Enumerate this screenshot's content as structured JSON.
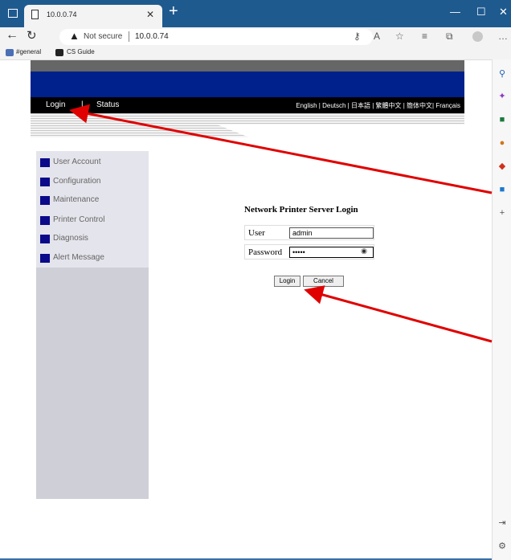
{
  "browser": {
    "tab_title": "10.0.0.74",
    "not_secure": "Not secure",
    "url": "10.0.0.74",
    "bookmarks": [
      {
        "label": "#general"
      },
      {
        "label": "CS Guide"
      }
    ]
  },
  "header": {
    "nav_login": "Login",
    "nav_sep": "|",
    "nav_status": "Status",
    "languages": "English | Deutsch | 日本語 | 繁體中文 | 簡体中文| Français"
  },
  "sidebar": {
    "items": [
      {
        "label": "User Account"
      },
      {
        "label": "Configuration"
      },
      {
        "label": "Maintenance"
      },
      {
        "label": "Printer Control"
      },
      {
        "label": "Diagnosis"
      },
      {
        "label": "Alert Message"
      }
    ]
  },
  "login_form": {
    "title": "Network Printer Server Login",
    "user_label": "User",
    "user_value": "admin",
    "password_label": "Password",
    "password_value": "•••••",
    "login_button": "Login",
    "cancel_button": "Cancel"
  },
  "colors": {
    "header_blue": "#00218c",
    "menu_square": "#0a0a8a",
    "annotation_arrow": "#e00000"
  }
}
